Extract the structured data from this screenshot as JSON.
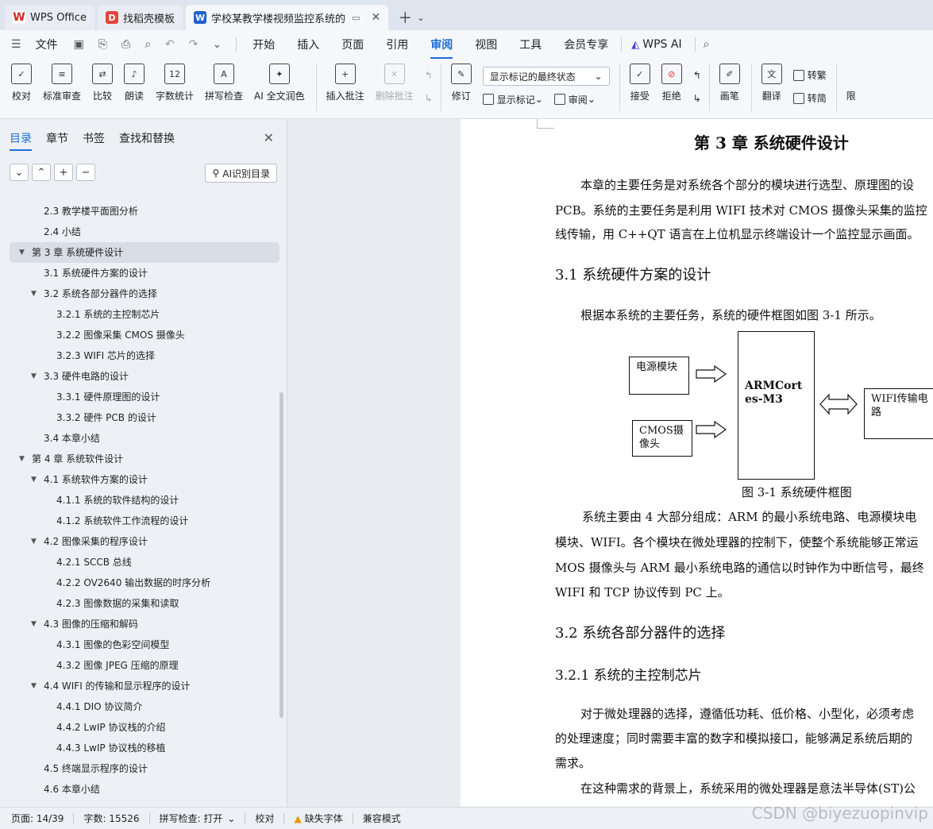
{
  "tabs": [
    {
      "label": "WPS Office"
    },
    {
      "label": "找稻壳模板"
    },
    {
      "label": "学校某教学楼视频监控系统的"
    }
  ],
  "menu": {
    "file": "文件",
    "items": [
      "开始",
      "插入",
      "页面",
      "引用",
      "审阅",
      "视图",
      "工具",
      "会员专享"
    ],
    "active": "审阅",
    "ai": "WPS AI"
  },
  "ribbon": {
    "buttons1": [
      "校对",
      "标准审查",
      "比较",
      "朗读",
      "字数统计",
      "拼写检查",
      "AI 全文润色"
    ],
    "buttons2": [
      "插入批注",
      "删除批注"
    ],
    "track": "修订",
    "markup_state": "显示标记的最终状态",
    "show_markup": "显示标记",
    "review": "审阅",
    "accept": "接受",
    "reject": "拒绝",
    "pen": "画笔",
    "translate": "翻译",
    "to_trad": "转繁",
    "to_simp": "转简",
    "limit": "限"
  },
  "nav": {
    "tabs": [
      "目录",
      "章节",
      "书签",
      "查找和替换"
    ],
    "ai_toc": "AI识别目录",
    "toc": [
      {
        "text": "2.3 教学楼平面图分析",
        "level": 2
      },
      {
        "text": "2.4 小结",
        "level": 2
      },
      {
        "text": "第 3 章 系统硬件设计",
        "level": 1,
        "selected": true
      },
      {
        "text": "3.1 系统硬件方案的设计",
        "level": 2
      },
      {
        "text": "3.2 系统各部分器件的选择",
        "level": 2,
        "expand": true
      },
      {
        "text": "3.2.1 系统的主控制芯片",
        "level": 3
      },
      {
        "text": "3.2.2 图像采集 CMOS 摄像头",
        "level": 3
      },
      {
        "text": "3.2.3 WIFI 芯片的选择",
        "level": 3
      },
      {
        "text": "3.3 硬件电路的设计",
        "level": 2,
        "expand": true
      },
      {
        "text": "3.3.1 硬件原理图的设计",
        "level": 3
      },
      {
        "text": "3.3.2 硬件 PCB 的设计",
        "level": 3
      },
      {
        "text": "3.4 本章小结",
        "level": 2
      },
      {
        "text": "第 4 章 系统软件设计",
        "level": 1,
        "expand": true
      },
      {
        "text": "4.1 系统软件方案的设计",
        "level": 2,
        "expand": true
      },
      {
        "text": "4.1.1 系统的软件结构的设计",
        "level": 3
      },
      {
        "text": "4.1.2 系统软件工作流程的设计",
        "level": 3
      },
      {
        "text": "4.2 图像采集的程序设计",
        "level": 2,
        "expand": true
      },
      {
        "text": "4.2.1 SCCB 总线",
        "level": 3
      },
      {
        "text": "4.2.2 OV2640 输出数据的时序分析",
        "level": 3
      },
      {
        "text": "4.2.3 图像数据的采集和读取",
        "level": 3
      },
      {
        "text": "4.3 图像的压缩和解码",
        "level": 2,
        "expand": true
      },
      {
        "text": "4.3.1 图像的色彩空间模型",
        "level": 3
      },
      {
        "text": "4.3.2 图像 JPEG 压缩的原理",
        "level": 3
      },
      {
        "text": "4.4 WIFI 的传输和显示程序的设计",
        "level": 2,
        "expand": true
      },
      {
        "text": "4.4.1 DIO 协议简介",
        "level": 3
      },
      {
        "text": "4.4.2 LwIP 协议栈的介绍",
        "level": 3
      },
      {
        "text": "4.4.3 LwIP 协议栈的移植",
        "level": 3
      },
      {
        "text": "4.5 终端显示程序的设计",
        "level": 2
      },
      {
        "text": "4.6 本章小结",
        "level": 2
      }
    ]
  },
  "doc": {
    "heading": "第 3 章 系统硬件设计",
    "para1": [
      "本章的主要任务是对系统各个部分的模块进行选型、原理图的设",
      "PCB。系统的主要任务是利用 WIFI 技术对 CMOS 摄像头采集的监控",
      "线传输，用 C++QT 语言在上位机显示终端设计一个监控显示画面。"
    ],
    "h31": "3.1 系统硬件方案的设计",
    "para2": "根据本系统的主要任务，系统的硬件框图如图 3-1 所示。",
    "diagram": {
      "power": "电源模块",
      "cmos": "CMOS摄像头",
      "arm": "ARMCortes-M3",
      "wifi": "WIFI传输电路"
    },
    "caption": "图 3-1 系统硬件框图",
    "para3": [
      "系统主要由 4 大部分组成：ARM 的最小系统电路、电源模块电",
      "模块、WIFI。各个模块在微处理器的控制下，使整个系统能够正常运",
      "MOS 摄像头与 ARM 最小系统电路的通信以时钟作为中断信号，最终",
      "WIFI 和 TCP 协议传到 PC 上。"
    ],
    "h32": "3.2 系统各部分器件的选择",
    "h321": "3.2.1 系统的主控制芯片",
    "para4": [
      "对于微处理器的选择，遵循低功耗、低价格、小型化，必须考虑",
      "的处理速度；同时需要丰富的数字和模拟接口，能够满足系统后期的",
      "需求。"
    ],
    "para5": "在这种需求的背景上，系统采用的微处理器是意法半导体(ST)公"
  },
  "status": {
    "page": "页面: 14/39",
    "words": "字数: 15526",
    "spell": "拼写检查: 打开",
    "proof": "校对",
    "missing_font": "缺失字体",
    "compat": "兼容模式"
  },
  "watermark": "CSDN @biyezuopinvip"
}
